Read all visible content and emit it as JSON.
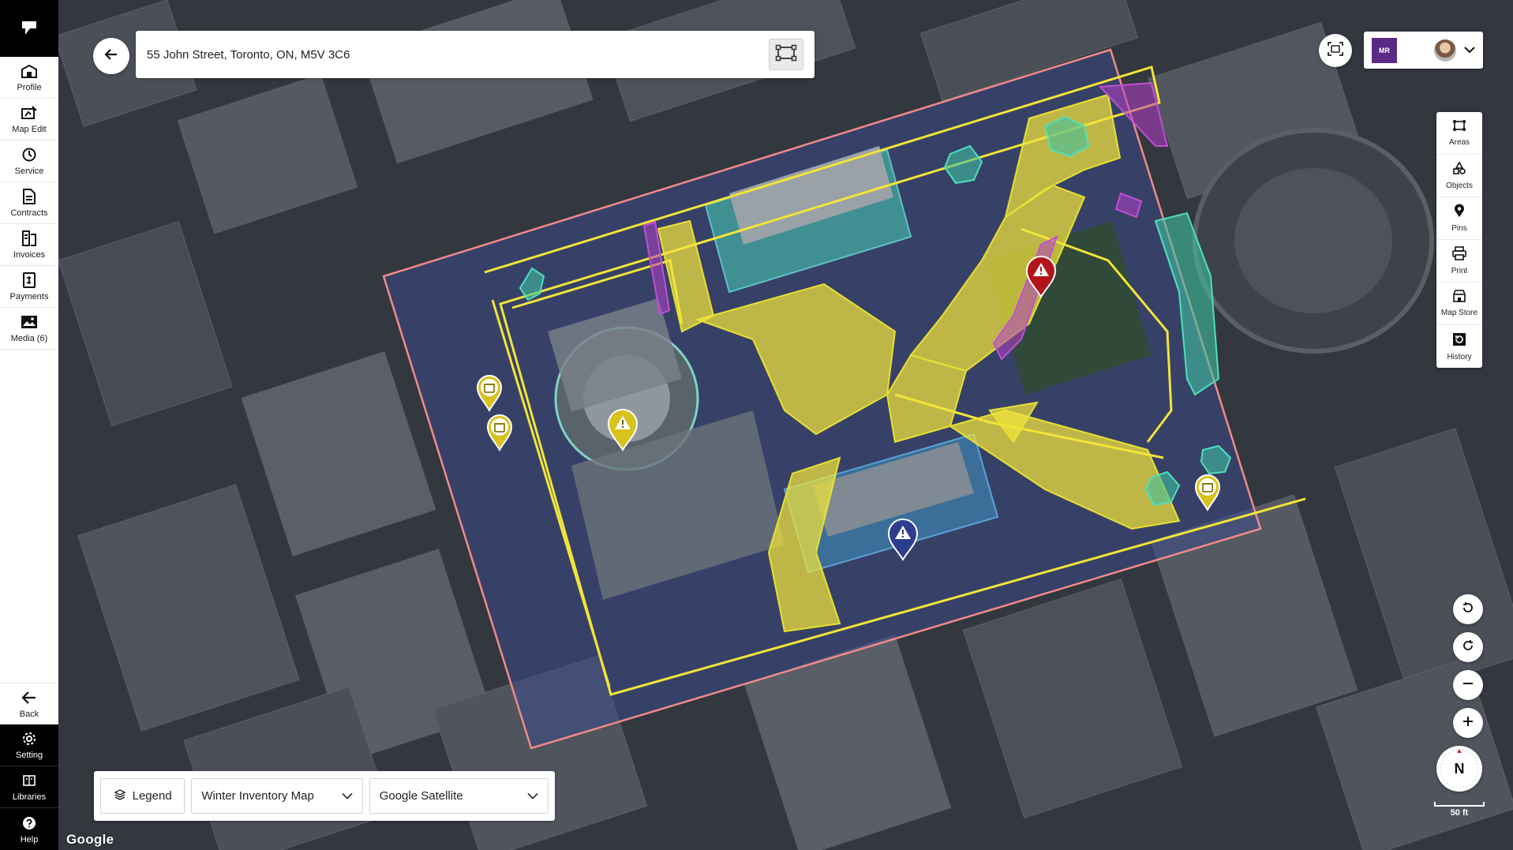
{
  "app": {
    "logo_icon": "brand-logo-icon"
  },
  "sidebar": {
    "items": [
      {
        "label": "Profile",
        "icon": "building-icon"
      },
      {
        "label": "Map Edit",
        "icon": "map-edit-icon"
      },
      {
        "label": "Service",
        "icon": "history-clock-icon"
      },
      {
        "label": "Contracts",
        "icon": "document-icon"
      },
      {
        "label": "Invoices",
        "icon": "invoice-icon"
      },
      {
        "label": "Payments",
        "icon": "payment-icon"
      },
      {
        "label": "Media (6)",
        "icon": "image-icon"
      }
    ],
    "bottom": [
      {
        "label": "Back",
        "icon": "arrow-left-icon"
      },
      {
        "label": "Setting",
        "icon": "gear-icon"
      },
      {
        "label": "Libraries",
        "icon": "library-icon"
      },
      {
        "label": "Help",
        "icon": "help-icon"
      }
    ]
  },
  "search": {
    "value": "55 John Street, Toronto, ON, M5V 3C6"
  },
  "account": {
    "company_logo_text": "MR"
  },
  "tools": [
    {
      "label": "Areas",
      "icon": "areas-icon"
    },
    {
      "label": "Objects",
      "icon": "objects-icon"
    },
    {
      "label": "Pins",
      "icon": "pin-icon"
    },
    {
      "label": "Print",
      "icon": "printer-icon"
    },
    {
      "label": "Map Store",
      "icon": "store-icon"
    },
    {
      "label": "History",
      "icon": "history-icon"
    }
  ],
  "map_controls": {
    "compass_label": "N",
    "scale_label": "50 ft",
    "attribution": "Google"
  },
  "bottom_bar": {
    "legend_label": "Legend",
    "map_select": "Winter Inventory Map",
    "basemap_select": "Google Satellite"
  },
  "colors": {
    "accent_yellow": "#f2e43a",
    "property_outline": "#f08a8a",
    "hazard_red": "#b3141b",
    "hazard_yellow": "#d8c21e",
    "hazard_blue": "#2f3d8f",
    "tree_green": "#3fbfa0",
    "zone_magenta": "#b23fc7"
  }
}
